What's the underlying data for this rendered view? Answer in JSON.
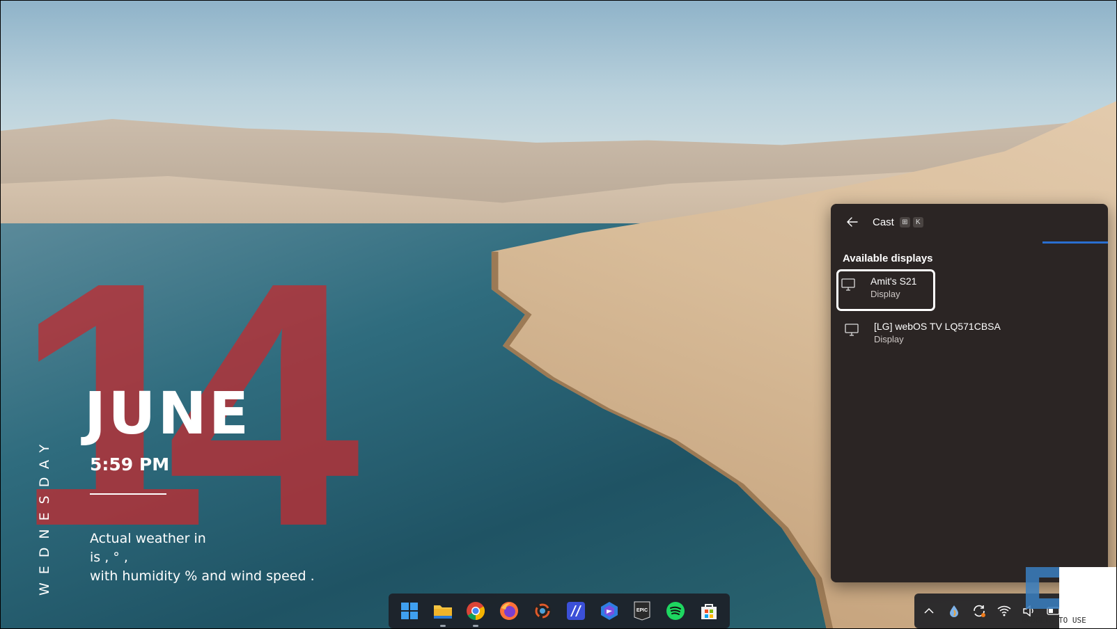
{
  "wallpaper_widget": {
    "day_number": "14",
    "weekday": "WEDNESDAY",
    "month": "JUNE",
    "time": "5:59 PM",
    "weather_lines": [
      "Actual weather in",
      "is , ° ,",
      "with humidity  % and wind speed  ."
    ]
  },
  "cast_panel": {
    "title": "Cast",
    "shortcut_keys": [
      "⊞",
      "K"
    ],
    "section_title": "Available displays",
    "devices": [
      {
        "name": "Amit's S21",
        "type": "Display",
        "selected": true
      },
      {
        "name": "[LG] webOS TV LQ571CBSA",
        "type": "Display",
        "selected": false
      }
    ],
    "accent_color": "#2a6fd0"
  },
  "taskbar": {
    "apps": [
      {
        "icon": "windows-start-icon"
      },
      {
        "icon": "file-explorer-icon",
        "running": true
      },
      {
        "icon": "chrome-icon",
        "running": true
      },
      {
        "icon": "firefox-icon"
      },
      {
        "icon": "davinci-resolve-icon"
      },
      {
        "icon": "app-icon"
      },
      {
        "icon": "bing-icon"
      },
      {
        "icon": "epic-games-icon",
        "label": "EPIC"
      },
      {
        "icon": "spotify-icon"
      },
      {
        "icon": "microsoft-store-icon"
      }
    ],
    "tray_icons": [
      "chevron-up-icon",
      "drop-icon",
      "sync-icon",
      "wifi-icon",
      "volume-icon",
      "battery-icon"
    ]
  },
  "watermark": {
    "text": "GADGETS TO USE"
  }
}
